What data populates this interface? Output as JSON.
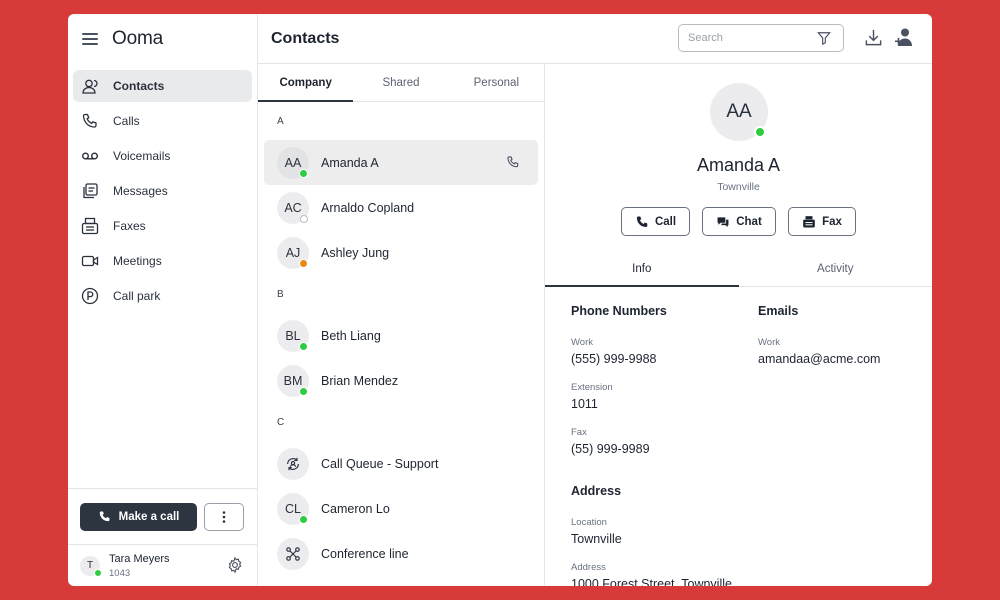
{
  "brand": {
    "name": "Ooma"
  },
  "nav": [
    {
      "label": "Contacts",
      "icon": "contacts-icon"
    },
    {
      "label": "Calls",
      "icon": "phone-icon"
    },
    {
      "label": "Voicemails",
      "icon": "voicemail-icon"
    },
    {
      "label": "Messages",
      "icon": "messages-icon"
    },
    {
      "label": "Faxes",
      "icon": "fax-icon"
    },
    {
      "label": "Meetings",
      "icon": "video-icon"
    },
    {
      "label": "Call park",
      "icon": "park-icon"
    }
  ],
  "make_call": {
    "label": "Make a call"
  },
  "user": {
    "initial": "T",
    "name": "Tara Meyers",
    "ext": "1043"
  },
  "header": {
    "title": "Contacts",
    "search_placeholder": "Search"
  },
  "tabs": [
    "Company",
    "Shared",
    "Personal"
  ],
  "sections": [
    {
      "letter": "A",
      "contacts": [
        {
          "initials": "AA",
          "name": "Amanda A",
          "status": "online"
        },
        {
          "initials": "AC",
          "name": "Arnaldo Copland",
          "status": "offline"
        },
        {
          "initials": "AJ",
          "name": "Ashley Jung",
          "status": "away"
        }
      ]
    },
    {
      "letter": "B",
      "contacts": [
        {
          "initials": "BL",
          "name": "Beth Liang",
          "status": "online"
        },
        {
          "initials": "BM",
          "name": "Brian Mendez",
          "status": "online"
        }
      ]
    },
    {
      "letter": "C",
      "contacts": [
        {
          "initials": "",
          "name": "Call Queue - Support",
          "status": ""
        },
        {
          "initials": "CL",
          "name": "Cameron Lo",
          "status": "online"
        },
        {
          "initials": "",
          "name": "Conference line",
          "status": ""
        }
      ]
    }
  ],
  "detail": {
    "initials": "AA",
    "name": "Amanda A",
    "location": "Townville",
    "actions": [
      "Call",
      "Chat",
      "Fax"
    ],
    "tabs": [
      "Info",
      "Activity"
    ],
    "phone": {
      "title": "Phone Numbers",
      "work_label": "Work",
      "work_value": "(555) 999-9988",
      "ext_label": "Extension",
      "ext_value": "1011",
      "fax_label": "Fax",
      "fax_value": "(55) 999-9989"
    },
    "emails": {
      "title": "Emails",
      "work_label": "Work",
      "work_value": "amandaa@acme.com"
    },
    "address": {
      "title": "Address",
      "location_label": "Location",
      "location_value": "Townville",
      "address_label": "Address",
      "address_value": "1000 Forest Street, Townville"
    }
  },
  "colors": {
    "background": "#d83a3a",
    "primary_button": "#2c3540",
    "online": "#2ecc40",
    "away": "#e88a1a"
  }
}
